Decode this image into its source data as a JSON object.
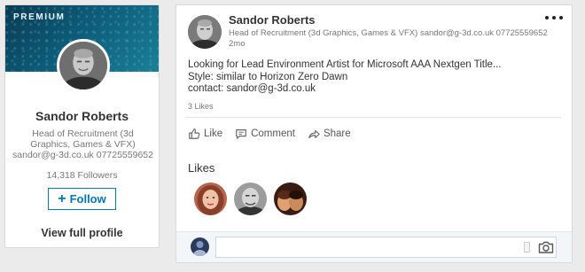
{
  "profile": {
    "premium_label": "PREMIUM",
    "name": "Sandor Roberts",
    "headline": "Head of Recruitment (3d Graphics, Games & VFX) sandor@g-3d.co.uk 07725559652",
    "followers": "14,318 Followers",
    "follow_label": "Follow",
    "view_profile_label": "View full profile"
  },
  "post": {
    "author_name": "Sandor Roberts",
    "author_headline": "Head of Recruitment (3d Graphics, Games & VFX) sandor@g-3d.co.uk 07725559652",
    "time": "2mo",
    "lines": [
      "Looking for Lead Environment Artist for Microsoft AAA Nextgen Title...",
      "Style: similar to Horizon Zero Dawn",
      "contact: sandor@g-3d.co.uk"
    ],
    "like_count": "3 Likes",
    "actions": {
      "like": "Like",
      "comment": "Comment",
      "share": "Share"
    },
    "likes_heading": "Likes",
    "comment_placeholder": ""
  },
  "colors": {
    "brand": "#0077b5",
    "banner": "#0d5b78"
  }
}
